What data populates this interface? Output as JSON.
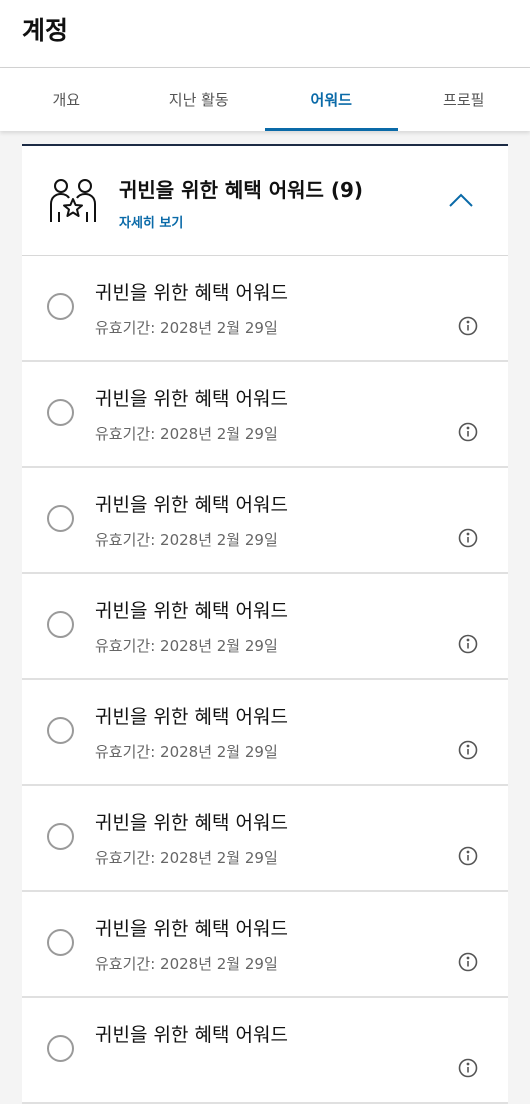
{
  "header": {
    "title": "계정"
  },
  "tabs": [
    {
      "label": "개요"
    },
    {
      "label": "지난 활동"
    },
    {
      "label": "어워드"
    },
    {
      "label": "프로필"
    }
  ],
  "card": {
    "title": "귀빈을 위한 혜택 어워드 (9)",
    "details_link": "자세히 보기",
    "people_icon": "people-star-icon",
    "collapse_icon": "chevron-up-icon"
  },
  "awards": [
    {
      "title": "귀빈을 위한 혜택 어워드",
      "expiry": "유효기간: 2028년 2월 29일"
    },
    {
      "title": "귀빈을 위한 혜택 어워드",
      "expiry": "유효기간: 2028년 2월 29일"
    },
    {
      "title": "귀빈을 위한 혜택 어워드",
      "expiry": "유효기간: 2028년 2월 29일"
    },
    {
      "title": "귀빈을 위한 혜택 어워드",
      "expiry": "유효기간: 2028년 2월 29일"
    },
    {
      "title": "귀빈을 위한 혜택 어워드",
      "expiry": "유효기간: 2028년 2월 29일"
    },
    {
      "title": "귀빈을 위한 혜택 어워드",
      "expiry": "유효기간: 2028년 2월 29일"
    },
    {
      "title": "귀빈을 위한 혜택 어워드",
      "expiry": "유효기간: 2028년 2월 29일"
    },
    {
      "title": "귀빈을 위한 혜택 어워드",
      "expiry": ""
    }
  ],
  "colors": {
    "accent": "#0a6aa8",
    "card_border": "#1c2b45"
  }
}
